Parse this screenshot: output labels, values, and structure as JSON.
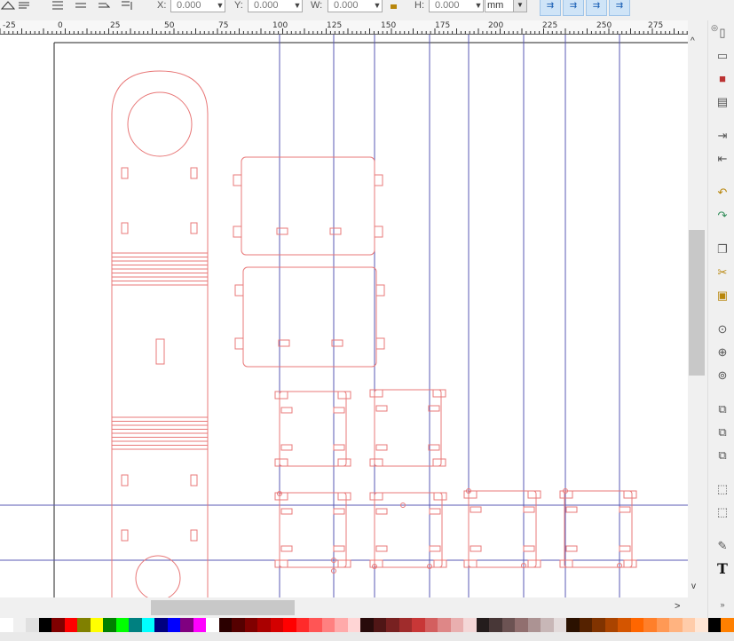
{
  "toolbar": {
    "x_label": "X:",
    "x_value": "0.000",
    "y_label": "Y:",
    "y_value": "0.000",
    "w_label": "W:",
    "w_value": "0.000",
    "h_label": "H:",
    "h_value": "0.000",
    "unit": "mm"
  },
  "ruler": {
    "labels": [
      "-25",
      "0",
      "25",
      "50",
      "75",
      "100",
      "125",
      "150",
      "175",
      "200",
      "225",
      "250",
      "275"
    ]
  },
  "palette": {
    "colors": [
      "#ffffff",
      "#f0f0f0",
      "#e0e0e0",
      "#000000",
      "#800000",
      "#ff0000",
      "#808000",
      "#ffff00",
      "#008000",
      "#00ff00",
      "#008080",
      "#00ffff",
      "#000080",
      "#0000ff",
      "#800080",
      "#ff00ff",
      "#ffffff",
      "#2b0000",
      "#550000",
      "#800000",
      "#aa0000",
      "#d40000",
      "#ff0000",
      "#ff2a2a",
      "#ff5555",
      "#ff8080",
      "#ffaaaa",
      "#ffd5d5",
      "#280b0b",
      "#501616",
      "#782121",
      "#a02c2c",
      "#c83737",
      "#d35f5f",
      "#de8787",
      "#e9afaf",
      "#f4d7d7",
      "#241c1c",
      "#483737",
      "#6c5353",
      "#916f6f",
      "#ac9393",
      "#c8b7b7",
      "#e3dbdb",
      "#2b1100",
      "#552200",
      "#803300",
      "#aa4400",
      "#d45500",
      "#ff6600",
      "#ff7f2a",
      "#ff9955",
      "#ffb380",
      "#ffccaa",
      "#ffe6d5",
      "#000000",
      "#ff8000"
    ]
  },
  "canvas": {
    "stroke_color": "#e87878",
    "guide_color": "#5a5ab4"
  }
}
